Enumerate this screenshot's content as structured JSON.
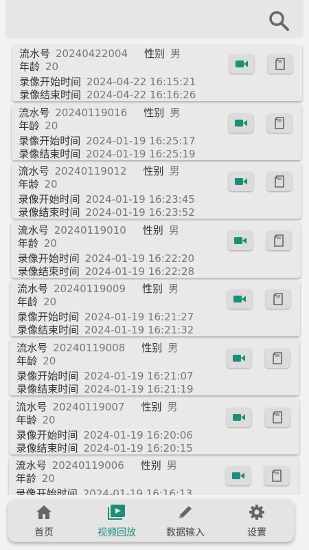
{
  "labels": {
    "serial": "流水号",
    "gender": "性别",
    "age": "年龄",
    "start_time": "录像开始时间",
    "end_time": "录像结束时间"
  },
  "records": [
    {
      "serial": "20240422004",
      "gender": "男",
      "age": "20",
      "start": "2024-04-22 16:15:21",
      "end": "2024-04-22 16:16:26"
    },
    {
      "serial": "20240119016",
      "gender": "男",
      "age": "20",
      "start": "2024-01-19 16:25:17",
      "end": "2024-01-19 16:25:19"
    },
    {
      "serial": "20240119012",
      "gender": "男",
      "age": "20",
      "start": "2024-01-19 16:23:45",
      "end": "2024-01-19 16:23:52"
    },
    {
      "serial": "20240119010",
      "gender": "男",
      "age": "20",
      "start": "2024-01-19 16:22:20",
      "end": "2024-01-19 16:22:28"
    },
    {
      "serial": "20240119009",
      "gender": "男",
      "age": "20",
      "start": "2024-01-19 16:21:27",
      "end": "2024-01-19 16:21:32"
    },
    {
      "serial": "20240119008",
      "gender": "男",
      "age": "20",
      "start": "2024-01-19 16:21:07",
      "end": "2024-01-19 16:21:19"
    },
    {
      "serial": "20240119007",
      "gender": "男",
      "age": "20",
      "start": "2024-01-19 16:20:06",
      "end": "2024-01-19 16:20:15"
    },
    {
      "serial": "20240119006",
      "gender": "男",
      "age": "20",
      "start": "2024-01-19 16:16:13",
      "end": ""
    }
  ],
  "nav": {
    "items": [
      {
        "label": "首页",
        "icon": "home-icon"
      },
      {
        "label": "视频回放",
        "icon": "video-playback-icon"
      },
      {
        "label": "数据输入",
        "icon": "pencil-icon"
      },
      {
        "label": "设置",
        "icon": "gear-icon"
      }
    ],
    "active_index": 1
  },
  "colors": {
    "accent": "#1a8f7a",
    "icon_gray": "#777777"
  }
}
